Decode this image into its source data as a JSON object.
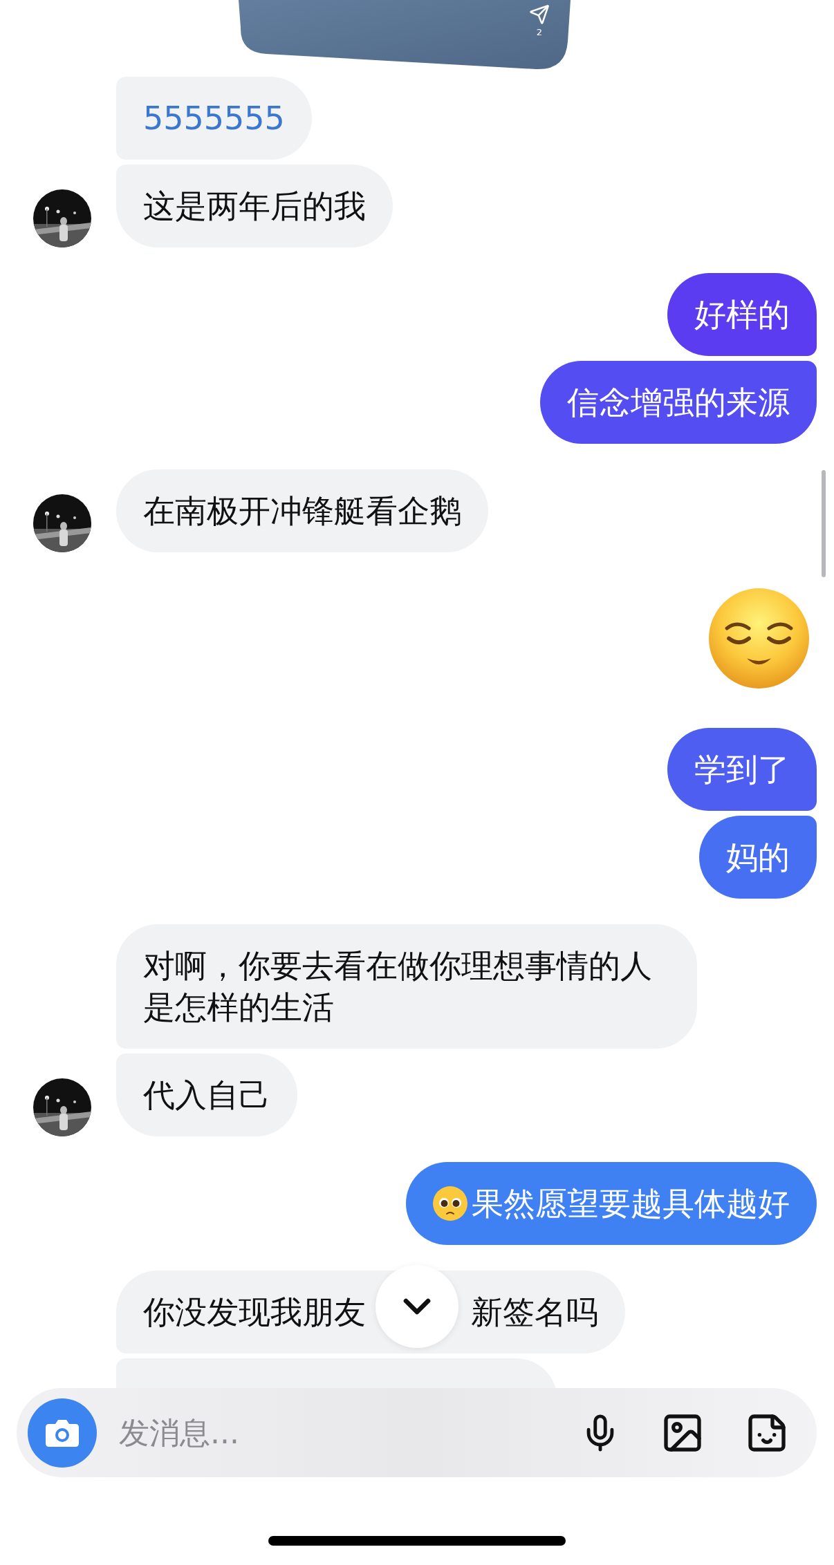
{
  "messages": [
    {
      "kind": "post",
      "outgoing": false,
      "count": "2"
    },
    {
      "kind": "text",
      "outgoing": false,
      "text": "5555555",
      "link": true,
      "avatar": false
    },
    {
      "kind": "text",
      "outgoing": false,
      "text": "这是两年后的我",
      "link": false,
      "avatar": true
    },
    {
      "kind": "text",
      "outgoing": true,
      "text": "好样的"
    },
    {
      "kind": "text",
      "outgoing": true,
      "text": "信念增强的来源"
    },
    {
      "kind": "text",
      "outgoing": false,
      "text": "在南极开冲锋艇看企鹅",
      "link": false,
      "avatar": true
    },
    {
      "kind": "emoji",
      "outgoing": true
    },
    {
      "kind": "text",
      "outgoing": true,
      "text": "学到了"
    },
    {
      "kind": "text",
      "outgoing": true,
      "text": "妈的"
    },
    {
      "kind": "text",
      "outgoing": false,
      "text": "对啊，你要去看在做你理想事情的人是怎样的生活",
      "link": false,
      "avatar": false
    },
    {
      "kind": "text",
      "outgoing": false,
      "text": "代入自己",
      "link": false,
      "avatar": true
    },
    {
      "kind": "emoji_text",
      "outgoing": true,
      "text": "果然愿望要越具体越好"
    },
    {
      "kind": "covered",
      "outgoing": false,
      "parts": [
        "你没发现我朋友",
        "新签名吗"
      ]
    },
    {
      "kind": "cut",
      "outgoing": false
    }
  ],
  "composer": {
    "placeholder": "发消息..."
  }
}
